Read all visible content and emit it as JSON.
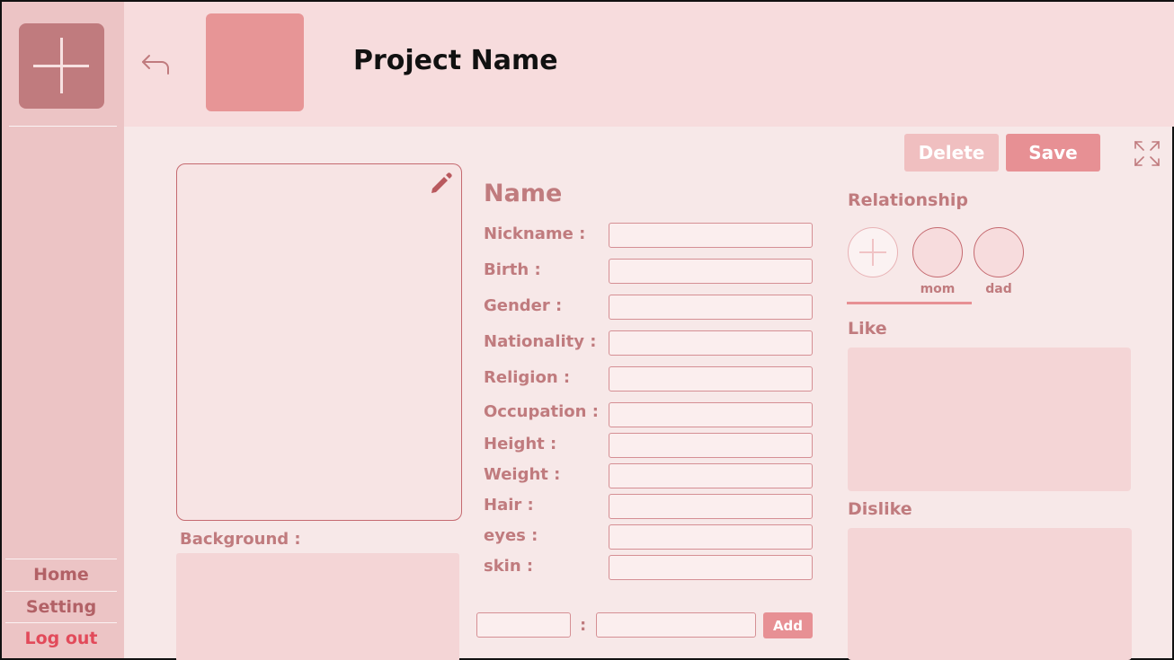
{
  "header": {
    "project_name": "Project Name"
  },
  "sidebar": {
    "home": "Home",
    "setting": "Setting",
    "logout": "Log out"
  },
  "actions": {
    "delete": "Delete",
    "save": "Save"
  },
  "character": {
    "name_title": "Name",
    "background_label": "Background :",
    "fields": [
      {
        "label": "Nickname :",
        "value": ""
      },
      {
        "label": "Birth :",
        "value": ""
      },
      {
        "label": "Gender :",
        "value": ""
      },
      {
        "label": "Nationality :",
        "value": ""
      },
      {
        "label": "Religion :",
        "value": ""
      },
      {
        "label": "Occupation :",
        "value": ""
      },
      {
        "label": "Height :",
        "value": ""
      },
      {
        "label": "Weight :",
        "value": ""
      },
      {
        "label": "Hair :",
        "value": ""
      },
      {
        "label": "eyes :",
        "value": ""
      },
      {
        "label": "skin :",
        "value": ""
      }
    ],
    "custom_separator": ":",
    "add_label": "Add"
  },
  "relationship": {
    "label": "Relationship",
    "members": [
      {
        "name": "mom"
      },
      {
        "name": "dad"
      }
    ]
  },
  "like_label": "Like",
  "dislike_label": "Dislike",
  "icons": {
    "new_project": "plus-icon",
    "back": "back-arrow-icon",
    "edit": "pencil-icon",
    "expand": "expand-icon",
    "relation_add": "plus-icon"
  },
  "colors": {
    "accent": "#e79094",
    "text_accent": "#c07b7e",
    "sidebar": "#ecc4c5",
    "header": "#f7dcdd",
    "logout": "#e24a5a"
  }
}
